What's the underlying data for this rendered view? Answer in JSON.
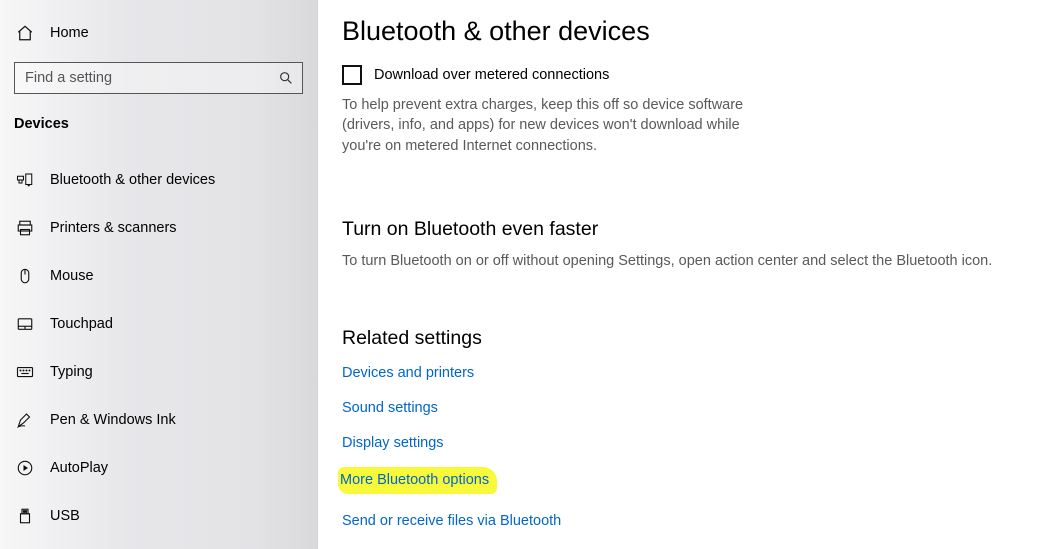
{
  "sidebar": {
    "home_label": "Home",
    "search_placeholder": "Find a setting",
    "section_title": "Devices",
    "items": [
      {
        "label": "Bluetooth & other devices"
      },
      {
        "label": "Printers & scanners"
      },
      {
        "label": "Mouse"
      },
      {
        "label": "Touchpad"
      },
      {
        "label": "Typing"
      },
      {
        "label": "Pen & Windows Ink"
      },
      {
        "label": "AutoPlay"
      },
      {
        "label": "USB"
      }
    ]
  },
  "main": {
    "page_title": "Bluetooth & other devices",
    "checkbox_label": "Download over metered connections",
    "checkbox_help": "To help prevent extra charges, keep this off so device software (drivers, info, and apps) for new devices won't download while you're on metered Internet connections.",
    "faster_heading": "Turn on Bluetooth even faster",
    "faster_desc": "To turn Bluetooth on or off without opening Settings, open action center and select the Bluetooth icon.",
    "related_heading": "Related settings",
    "links": {
      "devices_printers": "Devices and printers",
      "sound_settings": "Sound settings",
      "display_settings": "Display settings",
      "more_bt_options": "More Bluetooth options",
      "send_receive": "Send or receive files via Bluetooth"
    }
  }
}
